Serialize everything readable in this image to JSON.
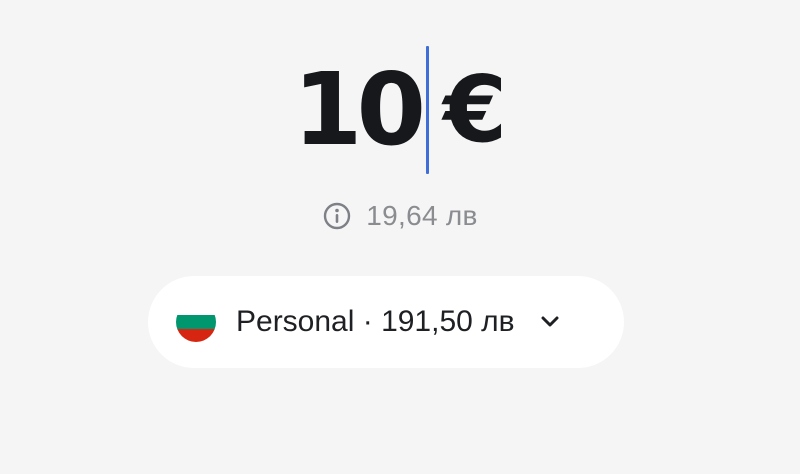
{
  "amount": {
    "value": "10",
    "currency_symbol": "€"
  },
  "conversion": {
    "icon": "info-icon",
    "text": "19,64 лв"
  },
  "account_selector": {
    "flag": "bulgaria-flag-icon",
    "flag_colors": [
      "#ffffff",
      "#00966e",
      "#d62612"
    ],
    "label": "Personal · 191,50 лв",
    "icon": "chevron-down-icon"
  },
  "colors": {
    "background": "#f5f5f6",
    "amount_text": "#16181b",
    "cursor": "#3f6fd6",
    "secondary_text": "#8a8c90"
  }
}
